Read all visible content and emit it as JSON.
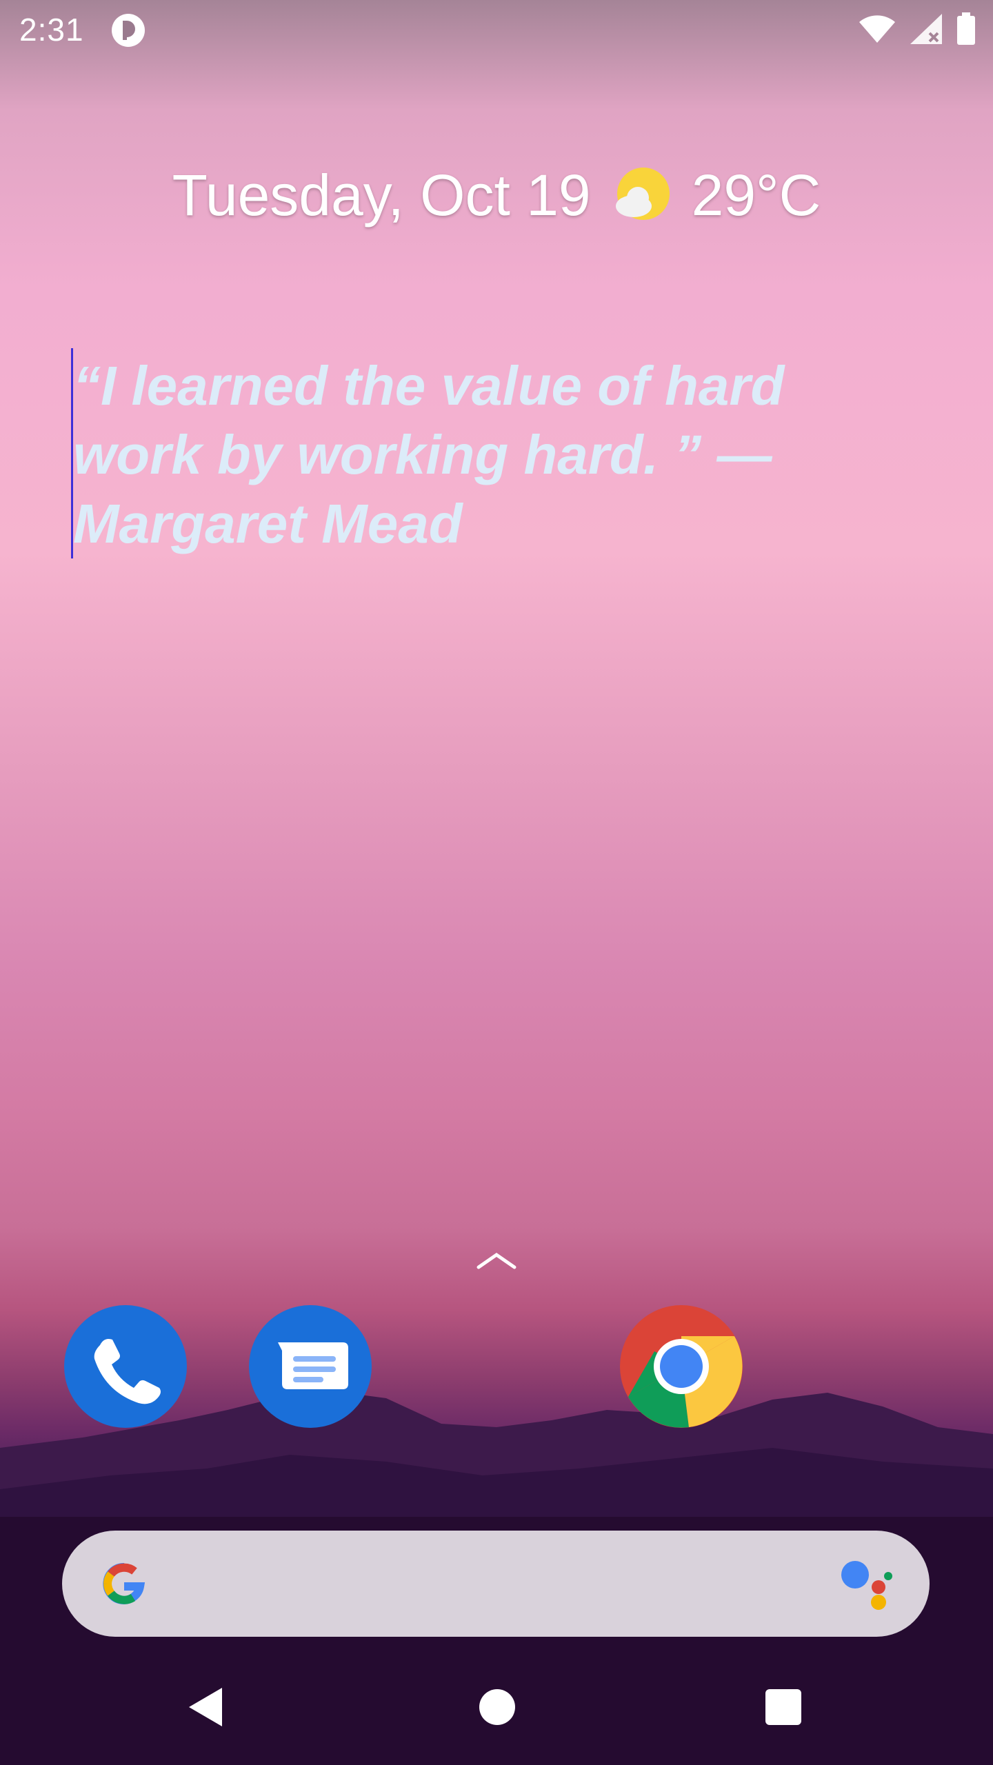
{
  "status_bar": {
    "time": "2:31"
  },
  "glance": {
    "date": "Tuesday, Oct 19",
    "temperature": "29°C",
    "weather_icon": "partly-cloudy-icon"
  },
  "quote_widget": {
    "text": "“I learned the value of hard work by working hard. ” — Margaret Mead"
  },
  "dock": {
    "apps": [
      "phone-icon",
      "messages-icon",
      "chrome-icon"
    ]
  },
  "search": {
    "logo": "google-g-icon",
    "assistant": "google-assistant-icon"
  },
  "navigation": {
    "buttons": [
      "back-icon",
      "home-icon",
      "recents-icon"
    ]
  }
}
